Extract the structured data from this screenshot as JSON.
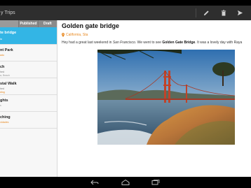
{
  "app": {
    "title": "y Trips"
  },
  "actionbar": {
    "actions": [
      {
        "name": "edit",
        "icon": "pencil-icon"
      },
      {
        "name": "delete",
        "icon": "trash-icon"
      },
      {
        "name": "share",
        "icon": "send-icon"
      }
    ]
  },
  "sidebar": {
    "tabs": [
      {
        "label": ""
      },
      {
        "label": "Published"
      },
      {
        "label": "Draft"
      }
    ],
    "trips": [
      {
        "title": "te bridge",
        "meta": "",
        "location": "ia",
        "selected": true
      },
      {
        "title": "nt Park",
        "meta": "",
        "location": "ado",
        "selected": false
      },
      {
        "title": "ch",
        "meta": "hed",
        "location": "a, Beach",
        "selected": false
      },
      {
        "title": "stal Walk",
        "meta": "hed",
        "location": "ding",
        "selected": false
      },
      {
        "title": "ghts",
        "meta": "",
        "location": "s",
        "selected": false
      },
      {
        "title": "ching",
        "meta": "",
        "location": "vidades",
        "selected": false
      }
    ]
  },
  "detail": {
    "title": "Golden gate bridge",
    "location": "California, Sta",
    "body_prefix": "Hey had a great last weekend in ",
    "body_city": "San Francisco",
    "body_middle": ". We went to see ",
    "body_landmark": "Golden Gate Bridge",
    "body_suffix": ". It was a lovely day with Raya",
    "photo": {
      "subject": "Golden Gate Bridge at sunset"
    }
  },
  "navbar": {
    "buttons": [
      {
        "name": "back",
        "icon": "back-icon"
      },
      {
        "name": "home",
        "icon": "home-icon"
      },
      {
        "name": "recents",
        "icon": "recents-icon"
      }
    ]
  },
  "colors": {
    "accent": "#33b5e5",
    "location": "#e8881f",
    "actionbar": "#2e2e2e"
  }
}
